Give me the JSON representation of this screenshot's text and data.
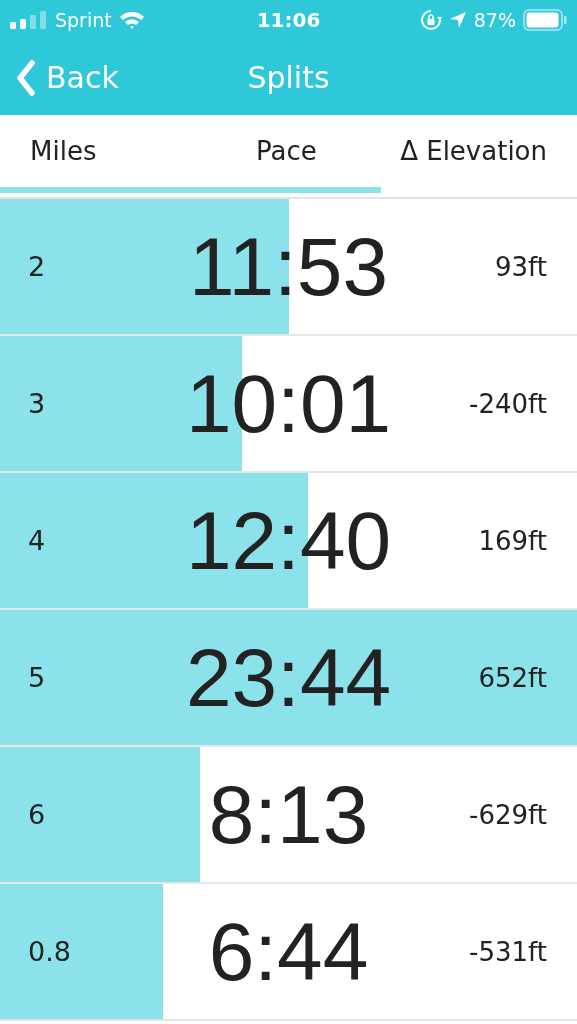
{
  "status_bar": {
    "carrier": "Sprint",
    "time": "11:06",
    "battery": "87%"
  },
  "nav": {
    "back": "Back",
    "title": "Splits"
  },
  "columns": [
    "Miles",
    "Pace",
    "Δ Elevation"
  ],
  "partial_row": {
    "level": 0.66
  },
  "rows": [
    {
      "miles": "2",
      "pace": "11:53",
      "elevation": "93ft",
      "level": 0.5
    },
    {
      "miles": "3",
      "pace": "10:01",
      "elevation": "-240ft",
      "level": 0.42
    },
    {
      "miles": "4",
      "pace": "12:40",
      "elevation": "169ft",
      "level": 0.534
    },
    {
      "miles": "5",
      "pace": "23:44",
      "elevation": "652ft",
      "level": 1.0
    },
    {
      "miles": "6",
      "pace": "8:13",
      "elevation": "-629ft",
      "level": 0.347
    },
    {
      "miles": "0.8",
      "pace": "6:44",
      "elevation": "-531ft",
      "level": 0.283
    }
  ]
}
